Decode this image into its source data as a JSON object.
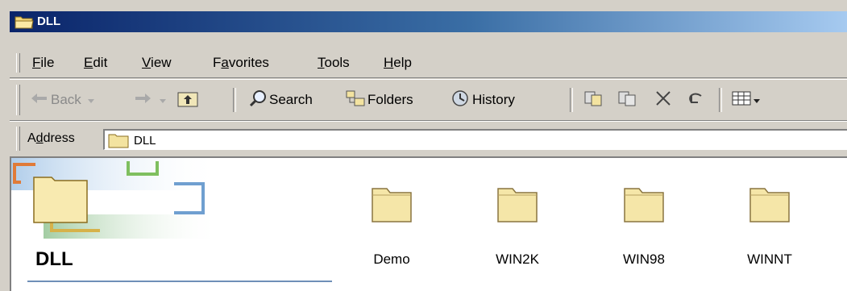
{
  "window": {
    "title": "DLL"
  },
  "menu": [
    {
      "pre": "",
      "key": "F",
      "post": "ile"
    },
    {
      "pre": "",
      "key": "E",
      "post": "dit"
    },
    {
      "pre": "",
      "key": "V",
      "post": "iew"
    },
    {
      "pre": "F",
      "key": "a",
      "post": "vorites"
    },
    {
      "pre": "",
      "key": "T",
      "post": "ools"
    },
    {
      "pre": "",
      "key": "H",
      "post": "elp"
    }
  ],
  "toolbar": {
    "back_label": "Back",
    "search_label": "Search",
    "folders_label": "Folders",
    "history_label": "History"
  },
  "address": {
    "label_pre": "A",
    "label_key": "d",
    "label_post": "dress",
    "value": "DLL"
  },
  "banner": {
    "title": "DLL"
  },
  "folders": [
    {
      "name": "Demo"
    },
    {
      "name": "WIN2K"
    },
    {
      "name": "WIN98"
    },
    {
      "name": "WINNT"
    }
  ],
  "colors": {
    "title_start": "#0a246a",
    "title_end": "#a6caf0",
    "folder": "#f5e6a8"
  }
}
